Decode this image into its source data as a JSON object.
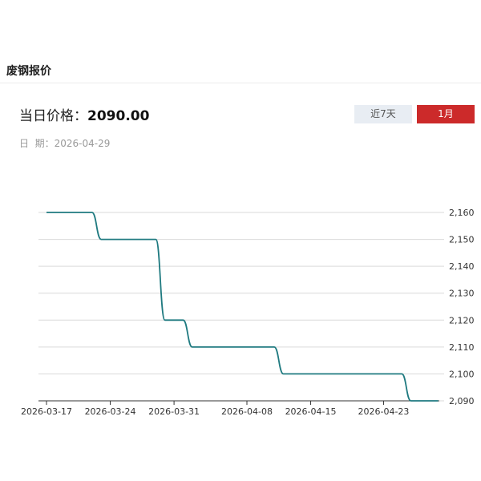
{
  "header": {
    "title": "废钢报价"
  },
  "price": {
    "label": "当日价格：",
    "value": "2090.00"
  },
  "date": {
    "label": "日  期：",
    "value": "2026-04-29"
  },
  "range_buttons": {
    "seven_days": "近7天",
    "one_month": "1月",
    "active": "1月"
  },
  "colors": {
    "line": "#1f7a80",
    "active_button": "#cc2a2a",
    "inactive_button": "#e8edf3",
    "grid": "#d9d9d9"
  },
  "chart_data": {
    "type": "line",
    "title": "",
    "xlabel": "",
    "ylabel": "",
    "grid": true,
    "y_axis_side": "right",
    "x": [
      "2026-03-17",
      "2026-03-18",
      "2026-03-19",
      "2026-03-20",
      "2026-03-21",
      "2026-03-22",
      "2026-03-23",
      "2026-03-24",
      "2026-03-25",
      "2026-03-26",
      "2026-03-27",
      "2026-03-28",
      "2026-03-29",
      "2026-03-30",
      "2026-03-31",
      "2026-04-01",
      "2026-04-02",
      "2026-04-03",
      "2026-04-04",
      "2026-04-05",
      "2026-04-06",
      "2026-04-07",
      "2026-04-08",
      "2026-04-09",
      "2026-04-10",
      "2026-04-11",
      "2026-04-12",
      "2026-04-13",
      "2026-04-14",
      "2026-04-15",
      "2026-04-16",
      "2026-04-17",
      "2026-04-18",
      "2026-04-19",
      "2026-04-20",
      "2026-04-21",
      "2026-04-22",
      "2026-04-23",
      "2026-04-24",
      "2026-04-25",
      "2026-04-26",
      "2026-04-27",
      "2026-04-28",
      "2026-04-29"
    ],
    "series": [
      {
        "values": [
          2160,
          2160,
          2160,
          2160,
          2160,
          2160,
          2150,
          2150,
          2150,
          2150,
          2150,
          2150,
          2150,
          2120,
          2120,
          2120,
          2110,
          2110,
          2110,
          2110,
          2110,
          2110,
          2110,
          2110,
          2110,
          2110,
          2100,
          2100,
          2100,
          2100,
          2100,
          2100,
          2100,
          2100,
          2100,
          2100,
          2100,
          2100,
          2100,
          2100,
          2090,
          2090,
          2090,
          2090
        ]
      }
    ],
    "ylim": [
      2090,
      2160
    ],
    "yticks": [
      "2,090",
      "2,100",
      "2,110",
      "2,120",
      "2,130",
      "2,140",
      "2,150",
      "2,160"
    ],
    "xticks": [
      "2026-03-17",
      "2026-03-24",
      "2026-03-31",
      "2026-04-08",
      "2026-04-15",
      "2026-04-23"
    ]
  }
}
